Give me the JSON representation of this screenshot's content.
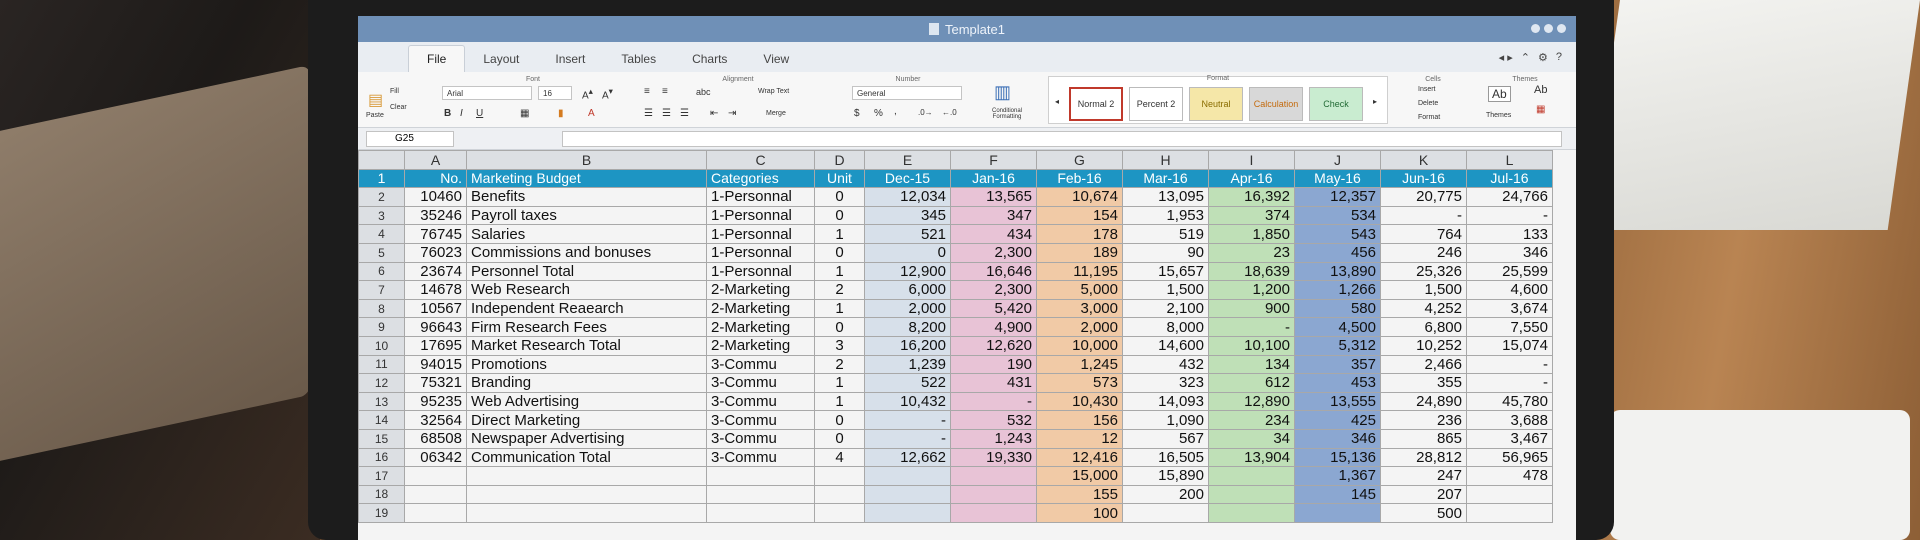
{
  "window": {
    "title": "Template1"
  },
  "tabs": [
    "File",
    "Layout",
    "Insert",
    "Tables",
    "Charts",
    "View"
  ],
  "ribbon": {
    "groups": {
      "font": "Font",
      "alignment": "Alignment",
      "number": "Number",
      "format": "Format",
      "cells": "Cells",
      "themes": "Themes"
    },
    "fill": "Fill",
    "clear": "Clear",
    "paste": "Paste",
    "font_name": "Arial",
    "font_size": "16",
    "bold": "B",
    "italic": "I",
    "underline": "U",
    "abc": "abc",
    "wrap_text": "Wrap Text",
    "merge": "Merge",
    "number_format": "General",
    "percent": "%",
    "comma": ",",
    "conditional_formatting": "Conditional Formatting",
    "styles": [
      "Normal 2",
      "Percent 2",
      "Neutral",
      "Calculation",
      "Check"
    ],
    "insert": "Insert",
    "delete": "Delete",
    "format_btn": "Format",
    "themes_label": "Themes",
    "theme_sample": "Ab"
  },
  "name_box": "G25",
  "columns": [
    "A",
    "B",
    "C",
    "D",
    "E",
    "F",
    "G",
    "H",
    "I",
    "J",
    "K",
    "L"
  ],
  "header_row": [
    "No.",
    "Marketing Budget",
    "Categories",
    "Unit",
    "Dec-15",
    "Jan-16",
    "Feb-16",
    "Mar-16",
    "Apr-16",
    "May-16",
    "Jun-16",
    "Jul-16"
  ],
  "rows": [
    [
      "10460",
      "Benefits",
      "1-Personnal",
      "0",
      "12,034",
      "13,565",
      "10,674",
      "13,095",
      "16,392",
      "12,357",
      "20,775",
      "24,766"
    ],
    [
      "35246",
      "Payroll taxes",
      "1-Personnal",
      "0",
      "345",
      "347",
      "154",
      "1,953",
      "374",
      "534",
      "-",
      "-"
    ],
    [
      "76745",
      "Salaries",
      "1-Personnal",
      "1",
      "521",
      "434",
      "178",
      "519",
      "1,850",
      "543",
      "764",
      "133"
    ],
    [
      "76023",
      "Commissions and bonuses",
      "1-Personnal",
      "0",
      "0",
      "2,300",
      "189",
      "90",
      "23",
      "456",
      "246",
      "346"
    ],
    [
      "23674",
      "Personnel Total",
      "1-Personnal",
      "1",
      "12,900",
      "16,646",
      "11,195",
      "15,657",
      "18,639",
      "13,890",
      "25,326",
      "25,599"
    ],
    [
      "14678",
      "Web Research",
      "2-Marketing",
      "2",
      "6,000",
      "2,300",
      "5,000",
      "1,500",
      "1,200",
      "1,266",
      "1,500",
      "4,600"
    ],
    [
      "10567",
      "Independent Reaearch",
      "2-Marketing",
      "1",
      "2,000",
      "5,420",
      "3,000",
      "2,100",
      "900",
      "580",
      "4,252",
      "3,674"
    ],
    [
      "96643",
      "Firm Research Fees",
      "2-Marketing",
      "0",
      "8,200",
      "4,900",
      "2,000",
      "8,000",
      "-",
      "4,500",
      "6,800",
      "7,550"
    ],
    [
      "17695",
      "Market Research Total",
      "2-Marketing",
      "3",
      "16,200",
      "12,620",
      "10,000",
      "14,600",
      "10,100",
      "5,312",
      "10,252",
      "15,074"
    ],
    [
      "94015",
      "Promotions",
      "3-Commu",
      "2",
      "1,239",
      "190",
      "1,245",
      "432",
      "134",
      "357",
      "2,466",
      "-"
    ],
    [
      "75321",
      "Branding",
      "3-Commu",
      "1",
      "522",
      "431",
      "573",
      "323",
      "612",
      "453",
      "355",
      "-"
    ],
    [
      "95235",
      "Web Advertising",
      "3-Commu",
      "1",
      "10,432",
      "-",
      "10,430",
      "14,093",
      "12,890",
      "13,555",
      "24,890",
      "45,780"
    ],
    [
      "32564",
      "Direct Marketing",
      "3-Commu",
      "0",
      "-",
      "532",
      "156",
      "1,090",
      "234",
      "425",
      "236",
      "3,688"
    ],
    [
      "68508",
      "Newspaper Advertising",
      "3-Commu",
      "0",
      "-",
      "1,243",
      "12",
      "567",
      "34",
      "346",
      "865",
      "3,467"
    ],
    [
      "06342",
      "Communication Total",
      "3-Commu",
      "4",
      "12,662",
      "19,330",
      "12,416",
      "16,505",
      "13,904",
      "15,136",
      "28,812",
      "56,965"
    ],
    [
      "",
      "",
      "",
      "",
      "",
      "",
      "15,000",
      "15,890",
      "",
      "1,367",
      "247",
      "478"
    ],
    [
      "",
      "",
      "",
      "",
      "",
      "",
      "155",
      "200",
      "",
      "145",
      "207",
      ""
    ],
    [
      "",
      "",
      "",
      "",
      "",
      "",
      "100",
      "",
      "",
      "",
      "500",
      ""
    ]
  ]
}
